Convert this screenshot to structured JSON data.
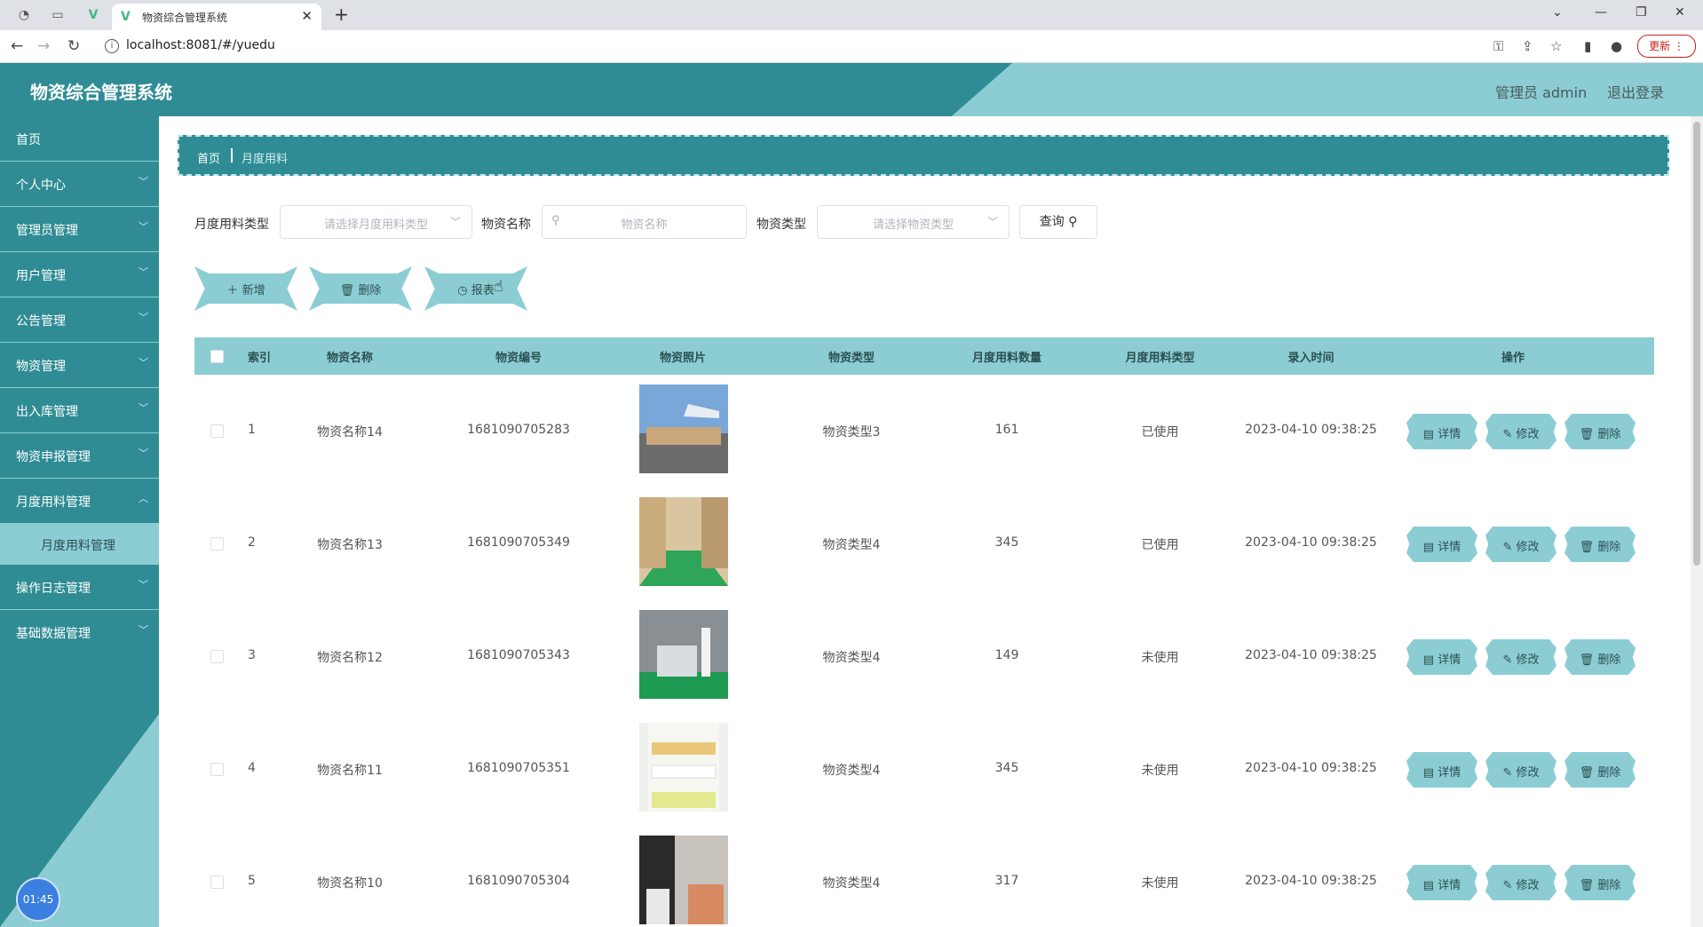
{
  "browser": {
    "tab_title": "物资综合管理系统",
    "url": "localhost:8081/#/yuedu",
    "update_label": "更新"
  },
  "header": {
    "title": "物资综合管理系统",
    "user": "管理员 admin",
    "logout": "退出登录"
  },
  "sidebar": {
    "items": [
      {
        "label": "首页"
      },
      {
        "label": "个人中心"
      },
      {
        "label": "管理员管理"
      },
      {
        "label": "用户管理"
      },
      {
        "label": "公告管理"
      },
      {
        "label": "物资管理"
      },
      {
        "label": "出入库管理"
      },
      {
        "label": "物资申报管理"
      },
      {
        "label": "月度用料管理"
      },
      {
        "label": "操作日志管理"
      },
      {
        "label": "基础数据管理"
      }
    ],
    "active_sub": "月度用料管理",
    "clock": "01:45"
  },
  "breadcrumb": {
    "home": "首页",
    "current": "月度用料"
  },
  "filters": {
    "type_label": "月度用料类型",
    "type_placeholder": "请选择月度用料类型",
    "name_label": "物资名称",
    "name_placeholder": "物资名称",
    "category_label": "物资类型",
    "category_placeholder": "请选择物资类型",
    "query_label": "查询"
  },
  "actions": {
    "add": "新增",
    "delete": "删除",
    "report": "报表"
  },
  "table": {
    "headers": [
      "索引",
      "物资名称",
      "物资编号",
      "物资照片",
      "物资类型",
      "月度用料数量",
      "月度用料类型",
      "录入时间",
      "操作"
    ],
    "op_labels": {
      "detail": "详情",
      "edit": "修改",
      "delete": "删除"
    },
    "rows": [
      {
        "index": "1",
        "name": "物资名称14",
        "code": "1681090705283",
        "type": "物资类型3",
        "qty": "161",
        "usage": "已使用",
        "time": "2023-04-10 09:38:25"
      },
      {
        "index": "2",
        "name": "物资名称13",
        "code": "1681090705349",
        "type": "物资类型4",
        "qty": "345",
        "usage": "已使用",
        "time": "2023-04-10 09:38:25"
      },
      {
        "index": "3",
        "name": "物资名称12",
        "code": "1681090705343",
        "type": "物资类型4",
        "qty": "149",
        "usage": "未使用",
        "time": "2023-04-10 09:38:25"
      },
      {
        "index": "4",
        "name": "物资名称11",
        "code": "1681090705351",
        "type": "物资类型4",
        "qty": "345",
        "usage": "未使用",
        "time": "2023-04-10 09:38:25"
      },
      {
        "index": "5",
        "name": "物资名称10",
        "code": "1681090705304",
        "type": "物资类型4",
        "qty": "317",
        "usage": "未使用",
        "time": "2023-04-10 09:38:25"
      }
    ]
  },
  "colors": {
    "primary": "#2f8c94",
    "accent": "#8ccdd4"
  }
}
